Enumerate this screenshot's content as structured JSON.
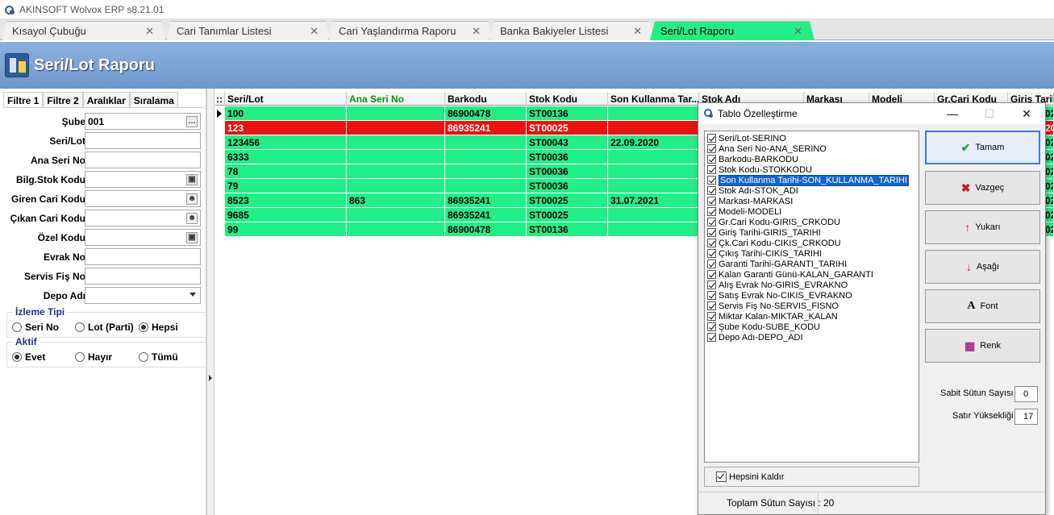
{
  "app": {
    "title": "AKINSOFT Wolvox ERP s8.21.01"
  },
  "tabs": [
    {
      "label": "Kısayol Çubuğu"
    },
    {
      "label": "Cari Tanımlar Listesi"
    },
    {
      "label": "Cari Yaşlandırma Raporu"
    },
    {
      "label": "Banka Bakiyeler Listesi"
    },
    {
      "label": "Seri/Lot Raporu"
    }
  ],
  "page": {
    "title": "Seri/Lot Raporu"
  },
  "filter": {
    "tabs": [
      "Filtre 1",
      "Filtre 2",
      "Aralıklar",
      "Sıralama"
    ],
    "fields": {
      "sube": {
        "label": "Şube",
        "value": "001"
      },
      "seri_lot": {
        "label": "Seri/Lot",
        "value": ""
      },
      "ana_seri_no": {
        "label": "Ana Seri No",
        "value": ""
      },
      "bilg_stok_kodu": {
        "label": "Bilg.Stok Kodu",
        "value": ""
      },
      "giren_cari_kodu": {
        "label": "Giren Cari Kodu",
        "value": ""
      },
      "cikan_cari_kodu": {
        "label": "Çıkan Cari Kodu",
        "value": ""
      },
      "ozel_kodu": {
        "label": "Özel Kodu",
        "value": ""
      },
      "evrak_no": {
        "label": "Evrak No",
        "value": ""
      },
      "servis_fis_no": {
        "label": "Servis Fiş No",
        "value": ""
      },
      "depo_adi": {
        "label": "Depo Adı",
        "value": ""
      }
    },
    "izleme_tipi": {
      "title": "İzleme Tipi",
      "options": [
        "Seri No",
        "Lot (Parti)",
        "Hepsi"
      ],
      "selected": "Hepsi"
    },
    "aktif": {
      "title": "Aktif",
      "options": [
        "Evet",
        "Hayır",
        "Tümü"
      ],
      "selected": "Evet"
    }
  },
  "grid": {
    "corner": "::",
    "columns": [
      "Seri/Lot",
      "Ana Seri No",
      "Barkodu",
      "Stok Kodu",
      "Son Kullanma Tar...",
      "Stok Adı",
      "Markası",
      "Modeli",
      "Gr.Cari Kodu",
      "Giriş Tarih"
    ],
    "rows": [
      {
        "seri_lot": "100",
        "ana_seri_no": "",
        "barkodu": "86900478",
        "stok_kodu": "ST00136",
        "son_kullanma": "",
        "status": "normal",
        "tail": "02"
      },
      {
        "seri_lot": "123",
        "ana_seri_no": "",
        "barkodu": "86935241",
        "stok_kodu": "ST00025",
        "son_kullanma": "",
        "status": "red",
        "tail": "20"
      },
      {
        "seri_lot": "123456",
        "ana_seri_no": "",
        "barkodu": "",
        "stok_kodu": "ST00043",
        "son_kullanma": "22.09.2020",
        "status": "normal",
        "tail": "02"
      },
      {
        "seri_lot": "6333",
        "ana_seri_no": "",
        "barkodu": "",
        "stok_kodu": "ST00036",
        "son_kullanma": "",
        "status": "normal",
        "tail": "02"
      },
      {
        "seri_lot": "78",
        "ana_seri_no": "",
        "barkodu": "",
        "stok_kodu": "ST00036",
        "son_kullanma": "",
        "status": "normal",
        "tail": "02"
      },
      {
        "seri_lot": "79",
        "ana_seri_no": "",
        "barkodu": "",
        "stok_kodu": "ST00036",
        "son_kullanma": "",
        "status": "normal",
        "tail": "02"
      },
      {
        "seri_lot": "8523",
        "ana_seri_no": "863",
        "barkodu": "86935241",
        "stok_kodu": "ST00025",
        "son_kullanma": "31.07.2021",
        "status": "normal",
        "tail": "02"
      },
      {
        "seri_lot": "9685",
        "ana_seri_no": "",
        "barkodu": "86935241",
        "stok_kodu": "ST00025",
        "son_kullanma": "",
        "status": "normal",
        "tail": "02"
      },
      {
        "seri_lot": "99",
        "ana_seri_no": "",
        "barkodu": "86900478",
        "stok_kodu": "ST00136",
        "son_kullanma": "",
        "status": "normal",
        "tail": "02"
      }
    ]
  },
  "dialog": {
    "title": "Tablo Özelleştirme",
    "columns": [
      "Seri/Lot-SERINO",
      "Ana Seri No-ANA_SERINO",
      "Barkodu-BARKODU",
      "Stok Kodu-STOKKODU",
      "Son Kullanma Tarihi-SON_KULLANMA_TARIHI",
      "Stok Adı-STOK_ADI",
      "Markası-MARKASI",
      "Modeli-MODELI",
      "Gr.Cari Kodu-GIRIS_CRKODU",
      "Giriş Tarihi-GIRIS_TARIHI",
      "Çk.Cari Kodu-CIKIS_CRKODU",
      "Çıkış Tarihi-CIKIS_TARIHI",
      "Garanti Tarihi-GARANTI_TARIHI",
      "Kalan Garanti Günü-KALAN_GARANTI",
      "Alış Evrak No-GIRIS_EVRAKNO",
      "Satış Evrak No-CIKIS_EVRAKNO",
      "Servis Fiş No-SERVIS_FISNO",
      "Miktar Kalan-MIKTAR_KALAN",
      "Şube Kodu-SUBE_KODU",
      "Depo Adı-DEPO_ADI"
    ],
    "selected_index": 4,
    "hepsini_kaldir": "Hepsini Kaldır",
    "buttons": {
      "tamam": "Tamam",
      "vazgec": "Vazgeç",
      "yukari": "Yukarı",
      "asagi": "Aşağı",
      "font": "Font",
      "renk": "Renk"
    },
    "sabit_sutun_label": "Sabit Sütun Sayısı",
    "sabit_sutun_value": "0",
    "satir_yuksekligi_label": "Satır Yüksekliği",
    "satir_yuksekligi_value": "17",
    "toplam_label": "Toplam Sütun Sayısı :",
    "toplam_value": "20"
  },
  "colors": {
    "row_green": "#22ee88",
    "row_red": "#ee1111",
    "header_blue": "#6f98cf",
    "accent": "#1a3399"
  }
}
